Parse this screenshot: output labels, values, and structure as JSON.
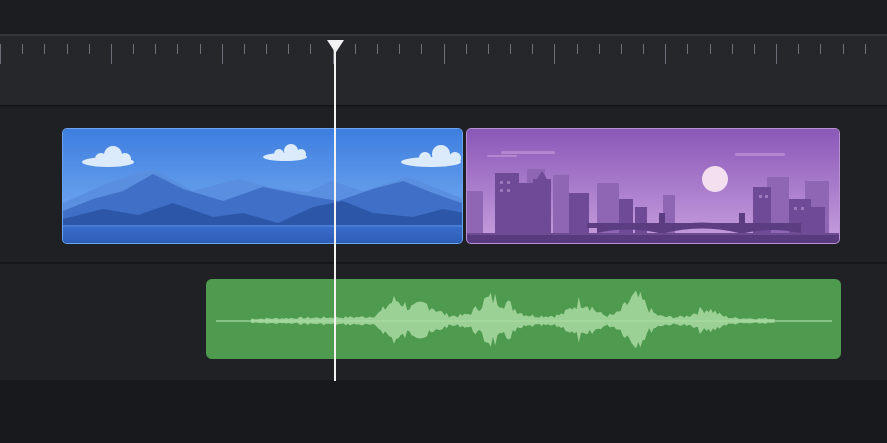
{
  "colors": {
    "background": "#1b1c1f",
    "ruler": "#25272b",
    "video_clip_1": "#3f76d6",
    "video_clip_2": "#9a6cc4",
    "audio_clip": "#4e9a4f",
    "waveform": "#a9dba0",
    "playhead": "#f2f2f2"
  },
  "timeline": {
    "ruler": {
      "major_ticks": 8,
      "minor_ticks": 40
    },
    "playhead_position": 0.378,
    "tracks": [
      {
        "type": "video",
        "clips": [
          {
            "icon": "mountain-landscape-thumbnail"
          },
          {
            "icon": "city-skyline-bridge-thumbnail"
          }
        ]
      },
      {
        "type": "audio",
        "clips": [
          {
            "icon": "audio-waveform"
          }
        ]
      }
    ]
  }
}
